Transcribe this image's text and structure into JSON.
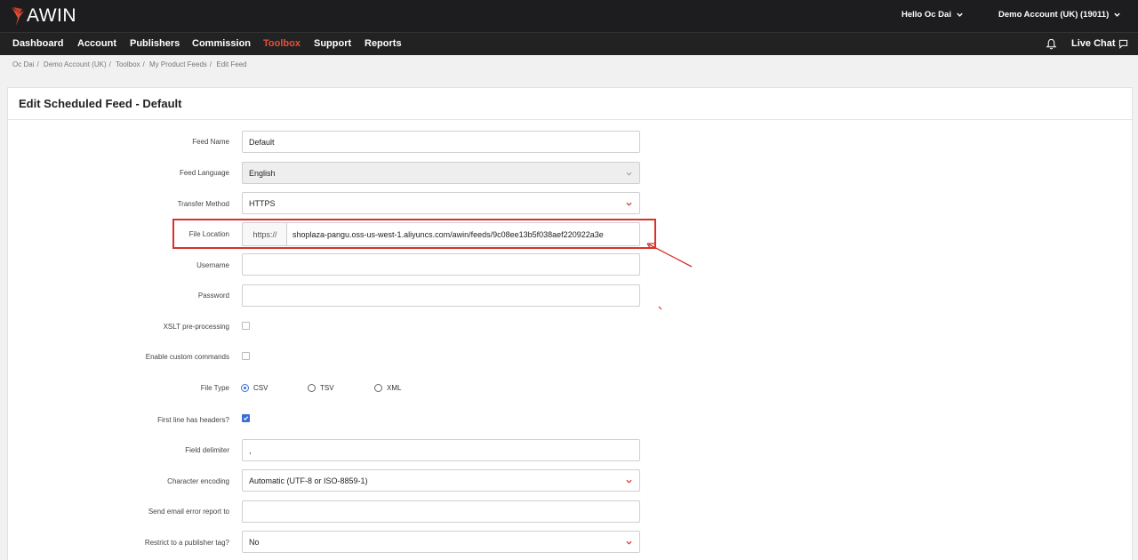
{
  "brand": {
    "logo_text": "AWIN",
    "accent": "#e3503d"
  },
  "topbar": {
    "greeting": "Hello Oc Dai",
    "account": "Demo Account (UK) (19011)"
  },
  "nav": {
    "items": [
      "Dashboard",
      "Account",
      "Publishers",
      "Commission",
      "Toolbox",
      "Support",
      "Reports"
    ],
    "active": "Toolbox",
    "live_chat": "Live Chat"
  },
  "breadcrumb": [
    "Oc Dai",
    "Demo Account (UK)",
    "Toolbox",
    "My Product Feeds",
    "Edit Feed"
  ],
  "page": {
    "title": "Edit Scheduled Feed - Default"
  },
  "form": {
    "feed_name": {
      "label": "Feed Name",
      "value": "Default"
    },
    "feed_language": {
      "label": "Feed Language",
      "value": "English"
    },
    "transfer_method": {
      "label": "Transfer Method",
      "value": "HTTPS"
    },
    "file_location": {
      "label": "File Location",
      "prefix": "https://",
      "value": "shoplaza-pangu.oss-us-west-1.aliyuncs.com/awin/feeds/9c08ee13b5f038aef220922a3e"
    },
    "username": {
      "label": "Username",
      "value": ""
    },
    "password": {
      "label": "Password",
      "value": ""
    },
    "xslt": {
      "label": "XSLT pre-processing",
      "checked": false
    },
    "custom_commands": {
      "label": "Enable custom commands",
      "checked": false
    },
    "file_type": {
      "label": "File Type",
      "options": [
        "CSV",
        "TSV",
        "XML"
      ],
      "selected": "CSV"
    },
    "first_line_headers": {
      "label": "First line has headers?",
      "checked": true
    },
    "field_delimiter": {
      "label": "Field delimiter",
      "value": ","
    },
    "character_encoding": {
      "label": "Character encoding",
      "value": "Automatic (UTF-8 or ISO-8859-1)"
    },
    "email_error": {
      "label": "Send email error report to",
      "value": ""
    },
    "publisher_tag": {
      "label": "Restrict to a publisher tag?",
      "value": "No"
    }
  },
  "icons": {
    "logo": "awin-bird-icon",
    "dropdown": "chevron-down-icon",
    "bell": "bell-icon",
    "chat": "chat-bubble-icon"
  },
  "annotation": {
    "color": "#d7322b"
  }
}
